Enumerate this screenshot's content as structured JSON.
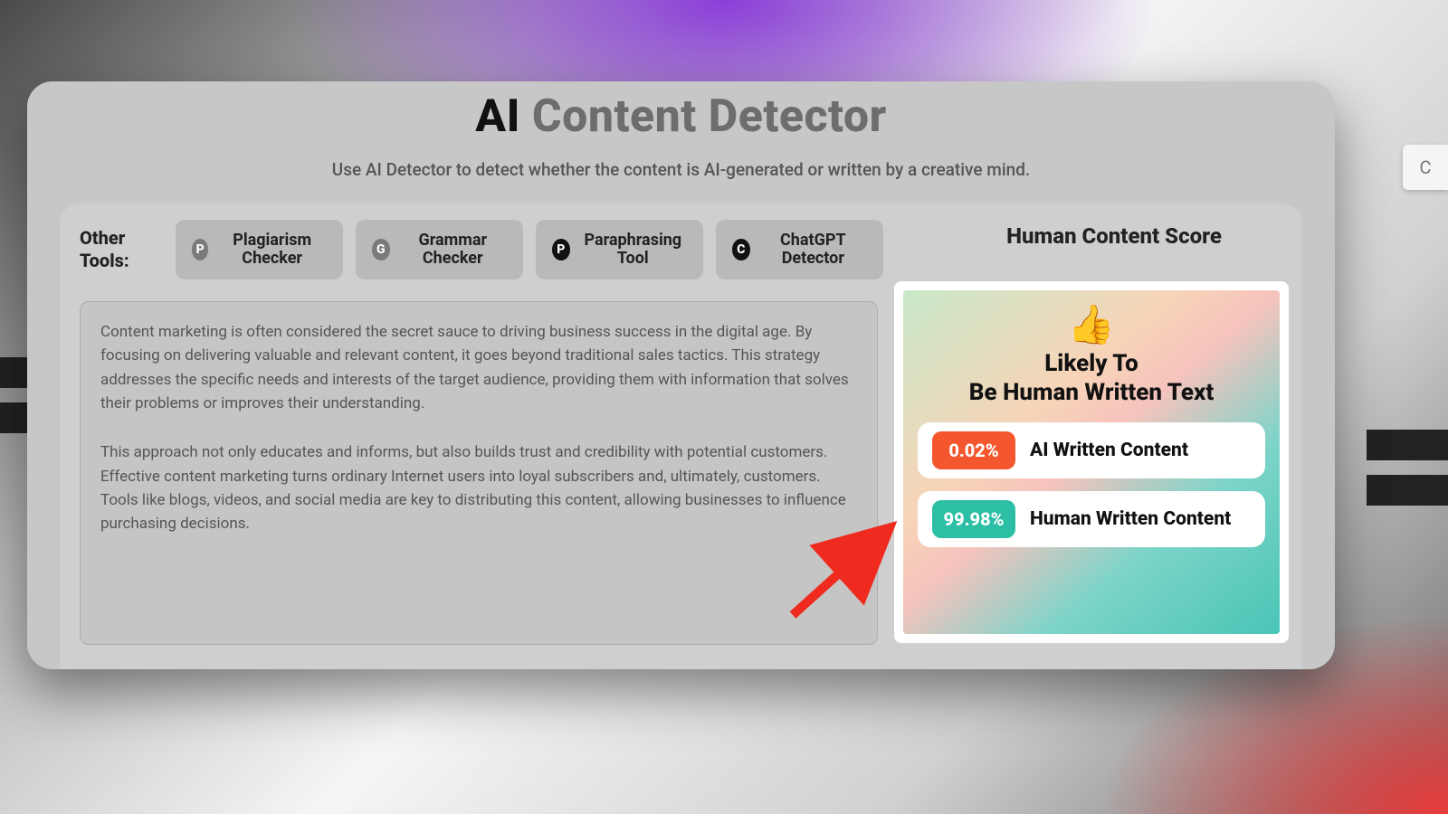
{
  "header": {
    "title_ai": "AI ",
    "title_rest": "Content Detector",
    "subtitle": "Use AI Detector to detect whether the content is AI-generated or written by a creative mind."
  },
  "toolbar": {
    "label": "Other Tools:",
    "items": [
      {
        "badge": "P",
        "badge_style": "gray",
        "label": "Plagiarism Checker"
      },
      {
        "badge": "G",
        "badge_style": "gray",
        "label": "Grammar Checker"
      },
      {
        "badge": "P",
        "badge_style": "black",
        "label": "Paraphrasing Tool"
      },
      {
        "badge": "C",
        "badge_style": "black",
        "label": "ChatGPT Detector"
      }
    ]
  },
  "content": {
    "p1": "Content marketing is often considered the secret sauce to driving business success in the digital age. By focusing on delivering valuable and relevant content, it goes beyond traditional sales tactics. This strategy addresses the specific needs and interests of the target audience, providing them with information that solves their problems or improves their understanding.",
    "p2": "This approach not only educates and informs, but also builds trust and credibility with potential customers. Effective content marketing turns ordinary Internet users into loyal subscribers and, ultimately, customers. Tools like blogs, videos, and social media are key to distributing this content, allowing businesses to influence purchasing decisions."
  },
  "score": {
    "title": "Human Content Score",
    "thumb": "👍",
    "likely_line1": "Likely To",
    "likely_line2": "Be Human Written Text",
    "ai_percent": "0.02%",
    "ai_label": "AI Written Content",
    "human_percent": "99.98%",
    "human_label": "Human Written Content"
  },
  "edge_chip": "C"
}
